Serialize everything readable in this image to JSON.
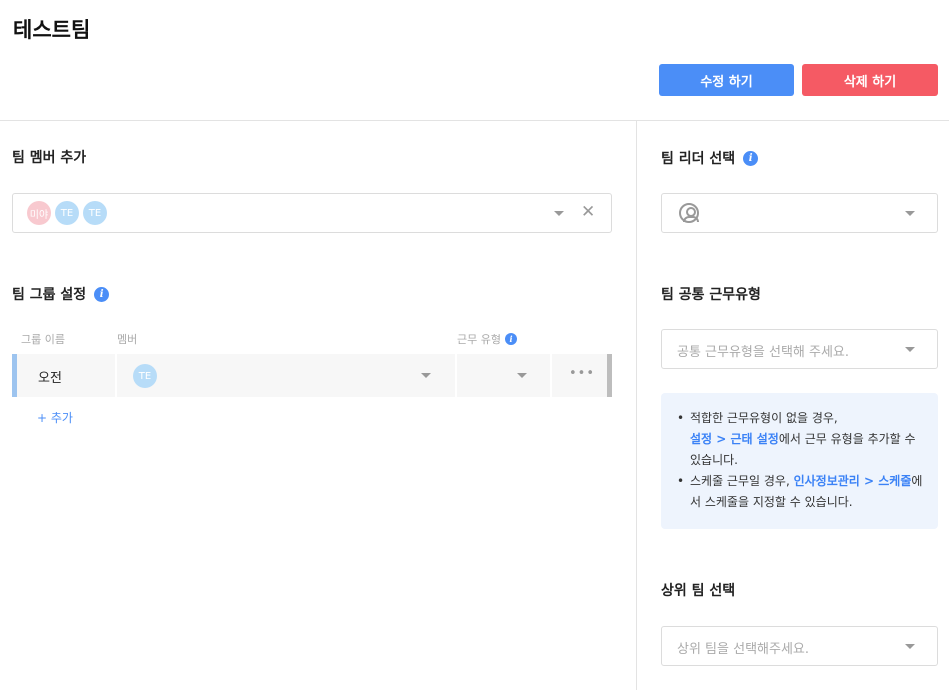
{
  "header": {
    "title": "테스트팀",
    "edit_label": "수정 하기",
    "delete_label": "삭제 하기"
  },
  "colors": {
    "primary": "#4b8ef7",
    "danger": "#f55a64",
    "notice_bg": "#eef4fd"
  },
  "members": {
    "title": "팀 멤버 추가",
    "chips": [
      "미야",
      "TE",
      "TE"
    ]
  },
  "groups": {
    "title": "팀 그룹 설정",
    "columns": [
      "그룹 이름",
      "멤버",
      "근무 유형"
    ],
    "rows": [
      {
        "name": "오전",
        "member_chip": "TE",
        "more": "•••"
      }
    ],
    "add_label": "+ 추가"
  },
  "leader": {
    "title": "팀 리더 선택"
  },
  "worktype": {
    "title": "팀 공통 근무유형",
    "placeholder": "공통 근무유형을 선택해 주세요."
  },
  "notice": {
    "item1_pre": "적합한 근무유형이 없을 경우,",
    "item1_link": "설정 > 근태 설정",
    "item1_post": "에서 근무 유형을 추가할 수 있습니다.",
    "item2_pre": "스케줄 근무일 경우, ",
    "item2_link": "인사정보관리 > 스케줄",
    "item2_post": "에서 스케줄을 지정할 수 있습니다."
  },
  "parent_team": {
    "title": "상위 팀 선택",
    "placeholder": "상위 팀을 선택해주세요."
  },
  "icons": {
    "info": "info-icon",
    "caret": "chevron-down-icon",
    "clear": "close-icon",
    "person": "user-circle-icon",
    "more": "more-horizontal-icon"
  }
}
